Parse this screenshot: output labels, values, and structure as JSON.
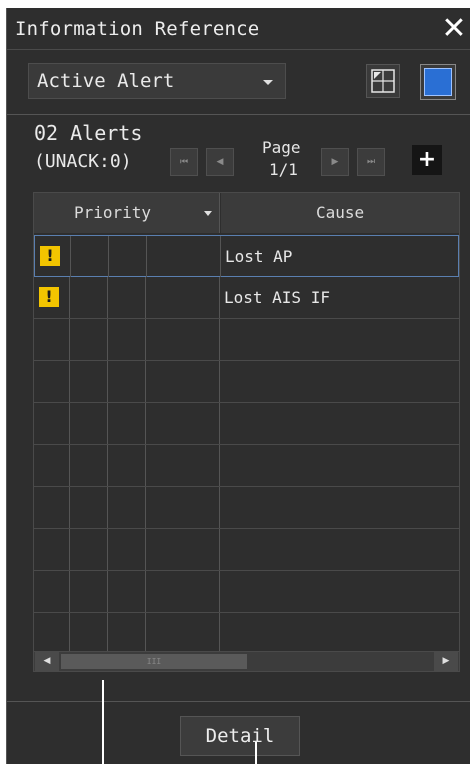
{
  "window": {
    "title": "Information Reference",
    "close_glyph": "✕"
  },
  "view_select": {
    "value": "Active Alert"
  },
  "summary": {
    "alerts_count": "02 Alerts",
    "unack": "(UNACK:0)"
  },
  "pagination": {
    "label": "Page",
    "value": "1/1",
    "first_glyph": "⏮",
    "prev_glyph": "◀",
    "next_glyph": "▶",
    "last_glyph": "⏭",
    "add_glyph": "+"
  },
  "table": {
    "columns": [
      "Priority",
      "Cause"
    ],
    "rows": [
      {
        "priority_icon": "!",
        "cause": "Lost AP"
      },
      {
        "priority_icon": "!",
        "cause": "Lost AIS IF"
      },
      {
        "priority_icon": "",
        "cause": ""
      },
      {
        "priority_icon": "",
        "cause": ""
      },
      {
        "priority_icon": "",
        "cause": ""
      },
      {
        "priority_icon": "",
        "cause": ""
      },
      {
        "priority_icon": "",
        "cause": ""
      },
      {
        "priority_icon": "",
        "cause": ""
      },
      {
        "priority_icon": "",
        "cause": ""
      },
      {
        "priority_icon": "",
        "cause": ""
      }
    ]
  },
  "scrollbar": {
    "left_glyph": "◀",
    "right_glyph": "▶",
    "thumb_grip": "III"
  },
  "footer": {
    "detail_label": "Detail"
  },
  "colors": {
    "panel_bg": "#2e2e2e",
    "warning": "#f2c400",
    "active_window_btn": "#2a6fd4"
  },
  "icons": {
    "window_restore": "restore-window-icon",
    "window_active": "active-window-icon"
  }
}
